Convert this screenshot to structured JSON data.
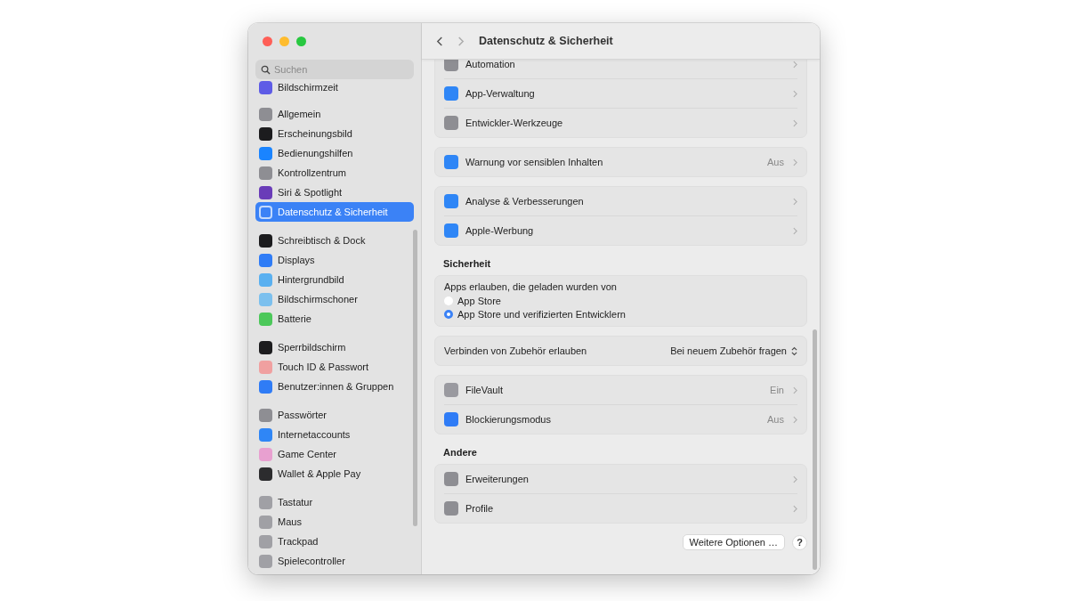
{
  "window": {
    "title": "Datenschutz & Sicherheit"
  },
  "search": {
    "placeholder": "Suchen"
  },
  "sidebar": {
    "groups": [
      [
        {
          "label": "Bildschirmzeit",
          "color": "#5e5ce6",
          "selected": false
        }
      ],
      [
        {
          "label": "Allgemein",
          "color": "#8e8e93",
          "selected": false
        },
        {
          "label": "Erscheinungsbild",
          "color": "#1c1c1e",
          "selected": false
        },
        {
          "label": "Bedienungshilfen",
          "color": "#1a84ff",
          "selected": false
        },
        {
          "label": "Kontrollzentrum",
          "color": "#8e8e93",
          "selected": false
        },
        {
          "label": "Siri & Spotlight",
          "color": "#6a3cb8",
          "selected": false
        },
        {
          "label": "Datenschutz & Sicherheit",
          "color": "#3b82f6",
          "selected": true
        }
      ],
      [
        {
          "label": "Schreibtisch & Dock",
          "color": "#1c1c1e",
          "selected": false
        },
        {
          "label": "Displays",
          "color": "#2f7cf6",
          "selected": false
        },
        {
          "label": "Hintergrundbild",
          "color": "#5ab0f0",
          "selected": false
        },
        {
          "label": "Bildschirmschoner",
          "color": "#7cc0ee",
          "selected": false
        },
        {
          "label": "Batterie",
          "color": "#4cc85a",
          "selected": false
        }
      ],
      [
        {
          "label": "Sperrbildschirm",
          "color": "#1c1c1e",
          "selected": false
        },
        {
          "label": "Touch ID & Passwort",
          "color": "#f0a0a0",
          "selected": false
        },
        {
          "label": "Benutzer:innen & Gruppen",
          "color": "#2f7cf6",
          "selected": false
        }
      ],
      [
        {
          "label": "Passwörter",
          "color": "#8e8e93",
          "selected": false
        },
        {
          "label": "Internetaccounts",
          "color": "#2f86f6",
          "selected": false
        },
        {
          "label": "Game Center",
          "color": "#e8a0d0",
          "selected": false
        },
        {
          "label": "Wallet & Apple Pay",
          "color": "#2c2c2e",
          "selected": false
        }
      ],
      [
        {
          "label": "Tastatur",
          "color": "#a0a0a5",
          "selected": false
        },
        {
          "label": "Maus",
          "color": "#a0a0a5",
          "selected": false
        },
        {
          "label": "Trackpad",
          "color": "#a0a0a5",
          "selected": false
        },
        {
          "label": "Spielecontroller",
          "color": "#a0a0a5",
          "selected": false
        }
      ]
    ]
  },
  "sections": [
    {
      "cards": [
        [
          {
            "kind": "link",
            "label": "Automation",
            "color": "#8e8e93"
          },
          {
            "kind": "link",
            "label": "App-Verwaltung",
            "color": "#2f86f6"
          },
          {
            "kind": "link",
            "label": "Entwickler-Werkzeuge",
            "color": "#8e8e93"
          }
        ],
        [
          {
            "kind": "link",
            "label": "Warnung vor sensiblen Inhalten",
            "value": "Aus",
            "color": "#2f86f6"
          }
        ],
        [
          {
            "kind": "link",
            "label": "Analyse & Verbesserungen",
            "color": "#2f86f6"
          },
          {
            "kind": "link",
            "label": "Apple-Werbung",
            "color": "#2f86f6"
          }
        ]
      ]
    },
    {
      "heading": "Sicherheit",
      "cards": [
        [
          {
            "kind": "radio",
            "label": "Apps erlauben, die geladen wurden von",
            "options": [
              {
                "label": "App Store",
                "selected": false
              },
              {
                "label": "App Store und verifizierten Entwicklern",
                "selected": true
              }
            ]
          }
        ],
        [
          {
            "kind": "popup",
            "label": "Verbinden von Zubehör erlauben",
            "value": "Bei neuem Zubehör fragen"
          }
        ],
        [
          {
            "kind": "link",
            "label": "FileVault",
            "value": "Ein",
            "color": "#9a9aa0"
          },
          {
            "kind": "link",
            "label": "Blockierungsmodus",
            "value": "Aus",
            "color": "#2f7cf6"
          }
        ]
      ]
    },
    {
      "heading": "Andere",
      "cards": [
        [
          {
            "kind": "link",
            "label": "Erweiterungen",
            "color": "#8e8e93"
          },
          {
            "kind": "link",
            "label": "Profile",
            "color": "#8e8e93"
          }
        ]
      ]
    }
  ],
  "footer": {
    "button": "Weitere Optionen …",
    "help": "?"
  }
}
